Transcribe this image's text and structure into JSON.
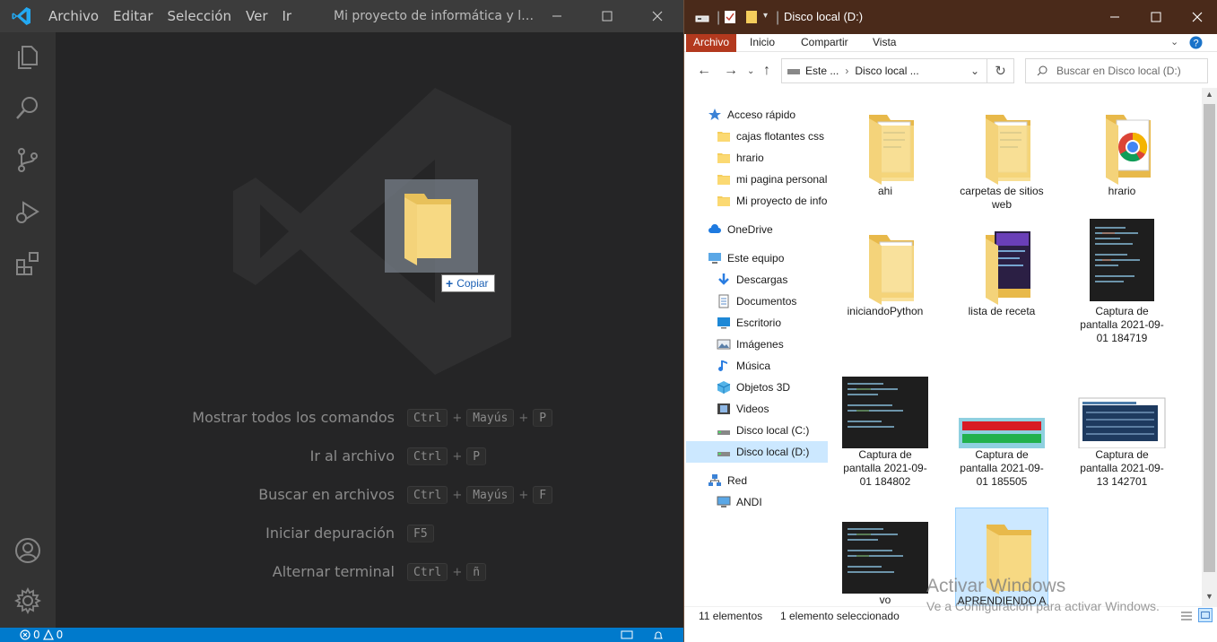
{
  "vscode": {
    "menu": [
      "Archivo",
      "Editar",
      "Selección",
      "Ver",
      "Ir"
    ],
    "title": "Mi proyecto de informática y leng...",
    "shortcuts": [
      {
        "label": "Mostrar todos los comandos",
        "keys": [
          "Ctrl",
          "Mayús",
          "P"
        ]
      },
      {
        "label": "Ir al archivo",
        "keys": [
          "Ctrl",
          "P"
        ]
      },
      {
        "label": "Buscar en archivos",
        "keys": [
          "Ctrl",
          "Mayús",
          "F"
        ]
      },
      {
        "label": "Iniciar depuración",
        "keys": [
          "F5"
        ]
      },
      {
        "label": "Alternar terminal",
        "keys": [
          "Ctrl",
          "ñ"
        ]
      }
    ],
    "drag_tooltip": "Copiar",
    "status": {
      "errors": "0",
      "warnings": "0"
    },
    "colors": {
      "statusbar": "#007acc",
      "titlebar": "#3c3c3c",
      "editor": "#252526"
    }
  },
  "explorer": {
    "title": "Disco local (D:)",
    "ribbon_tabs": [
      "Archivo",
      "Inicio",
      "Compartir",
      "Vista"
    ],
    "address": {
      "part1": "Este ...",
      "part2": "Disco local ..."
    },
    "search_placeholder": "Buscar en Disco local (D:)",
    "sidebar": [
      {
        "label": "Acceso rápido",
        "icon": "star-icon",
        "level": 0
      },
      {
        "label": "cajas flotantes css",
        "icon": "folder-icon",
        "level": 1
      },
      {
        "label": "hrario",
        "icon": "folder-icon",
        "level": 1
      },
      {
        "label": "mi pagina personal",
        "icon": "folder-icon",
        "level": 1
      },
      {
        "label": "Mi proyecto de infor",
        "icon": "folder-icon",
        "level": 1
      },
      {
        "label": "OneDrive",
        "icon": "cloud-icon",
        "level": 0
      },
      {
        "label": "Este equipo",
        "icon": "computer-icon",
        "level": 0
      },
      {
        "label": "Descargas",
        "icon": "download-icon",
        "level": 1
      },
      {
        "label": "Documentos",
        "icon": "document-icon",
        "level": 1
      },
      {
        "label": "Escritorio",
        "icon": "desktop-icon",
        "level": 1
      },
      {
        "label": "Imágenes",
        "icon": "image-icon",
        "level": 1
      },
      {
        "label": "Música",
        "icon": "music-icon",
        "level": 1
      },
      {
        "label": "Objetos 3D",
        "icon": "cube-icon",
        "level": 1
      },
      {
        "label": "Videos",
        "icon": "video-icon",
        "level": 1
      },
      {
        "label": "Disco local (C:)",
        "icon": "drive-icon",
        "level": 1
      },
      {
        "label": "Disco local (D:)",
        "icon": "drive-icon",
        "level": 1,
        "selected": true
      },
      {
        "label": "Red",
        "icon": "network-icon",
        "level": 0
      },
      {
        "label": "ANDI",
        "icon": "monitor-icon",
        "level": 1
      }
    ],
    "files": [
      {
        "name": "ahi",
        "kind": "folder-docs"
      },
      {
        "name": "carpetas de sitios web",
        "kind": "folder-docs"
      },
      {
        "name": "hrario",
        "kind": "folder-chrome"
      },
      {
        "name": "iniciandoPython",
        "kind": "folder-empty"
      },
      {
        "name": "lista de receta",
        "kind": "folder-image"
      },
      {
        "name": "Captura de pantalla 2021-09-01 184719",
        "kind": "screenshot-code-tall"
      },
      {
        "name": "Captura de pantalla 2021-09-01 184802",
        "kind": "screenshot-code"
      },
      {
        "name": "Captura de pantalla 2021-09-01 185505",
        "kind": "screenshot-bars"
      },
      {
        "name": "Captura de pantalla 2021-09-13 142701",
        "kind": "screenshot-table"
      },
      {
        "name": "vo",
        "kind": "screenshot-code"
      },
      {
        "name": "APRENDIENDO A",
        "kind": "folder-plain",
        "selected": true
      }
    ],
    "status": {
      "count": "11 elementos",
      "selection": "1 elemento seleccionado"
    },
    "colors": {
      "titlebar": "#4a2a1a",
      "archivo_tab": "#b3391e",
      "selection": "#cce8ff"
    }
  },
  "watermark": {
    "line1": "Activar Windows",
    "line2": "Ve a Configuración para activar Windows."
  }
}
